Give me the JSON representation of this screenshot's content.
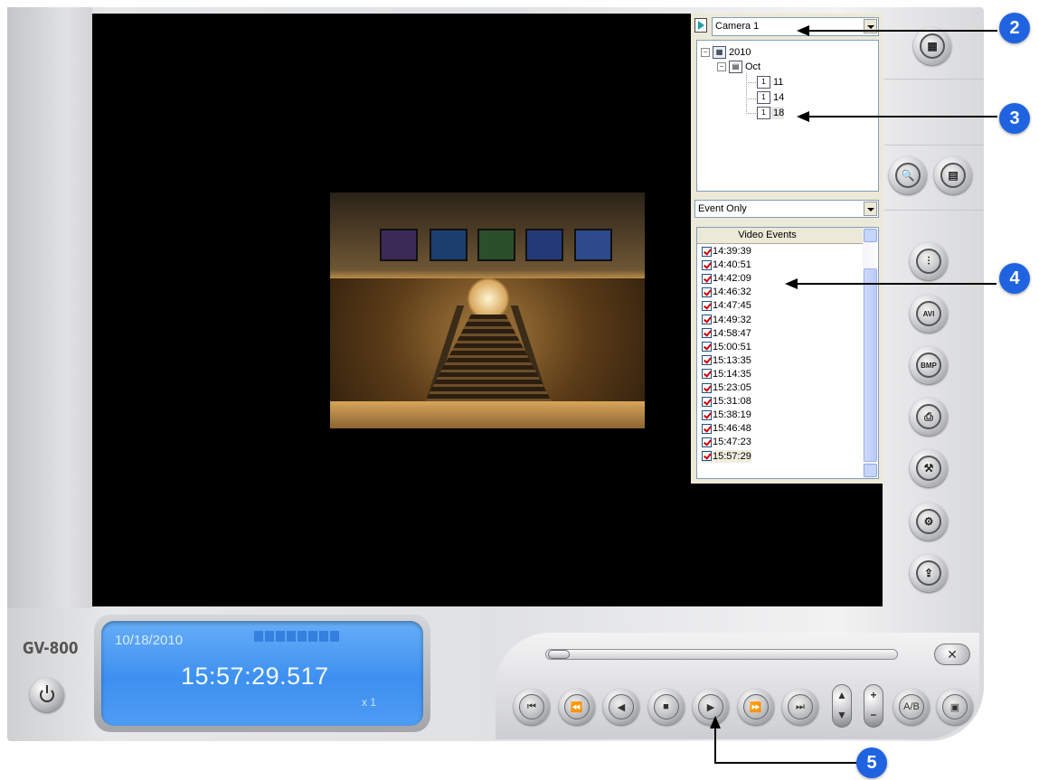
{
  "camera_select": {
    "value": "Camera 1"
  },
  "tree": {
    "year": "2010",
    "month": "Oct",
    "days": [
      "11",
      "14",
      "18"
    ]
  },
  "filter_select": {
    "value": "Event Only"
  },
  "events": {
    "header": "Video Events",
    "rows": [
      "14:39:39",
      "14:40:51",
      "14:42:09",
      "14:46:32",
      "14:47:45",
      "14:49:32",
      "14:58:47",
      "15:00:51",
      "15:13:35",
      "15:14:35",
      "15:23:05",
      "15:31:08",
      "15:38:19",
      "15:46:48",
      "15:47:23",
      "15:57:29"
    ]
  },
  "lcd": {
    "date": "10/18/2010",
    "time": "15:57:29.517",
    "speed": "x 1"
  },
  "brand": "GV-800",
  "side_buttons": [
    {
      "name": "layout-icon",
      "glyph": "▦"
    },
    {
      "name": "search-icon",
      "glyph": "🔍"
    },
    {
      "name": "document-icon",
      "glyph": "▤"
    },
    {
      "name": "equalizer-icon",
      "glyph": "⫶"
    },
    {
      "name": "save-avi-icon",
      "glyph": "AVI"
    },
    {
      "name": "save-bmp-icon",
      "glyph": "BMP"
    },
    {
      "name": "print-icon",
      "glyph": "⎙"
    },
    {
      "name": "tools-icon",
      "glyph": "⚒"
    },
    {
      "name": "settings-icon",
      "glyph": "⚙"
    },
    {
      "name": "export-icon",
      "glyph": "⇪"
    }
  ],
  "playback_buttons": [
    {
      "name": "skip-to-start-button",
      "glyph": "⏮"
    },
    {
      "name": "prev-frame-button",
      "glyph": "⏪"
    },
    {
      "name": "play-reverse-button",
      "glyph": "◀"
    },
    {
      "name": "stop-button",
      "glyph": "■"
    },
    {
      "name": "play-button",
      "glyph": "▶"
    },
    {
      "name": "next-frame-button",
      "glyph": "⏩"
    },
    {
      "name": "skip-to-end-button",
      "glyph": "⏭"
    }
  ],
  "callouts": [
    "2",
    "3",
    "4",
    "5"
  ],
  "colors": {
    "accent": "#1f63e0",
    "lcd": "#4d9cf4",
    "check": "#d10000"
  }
}
